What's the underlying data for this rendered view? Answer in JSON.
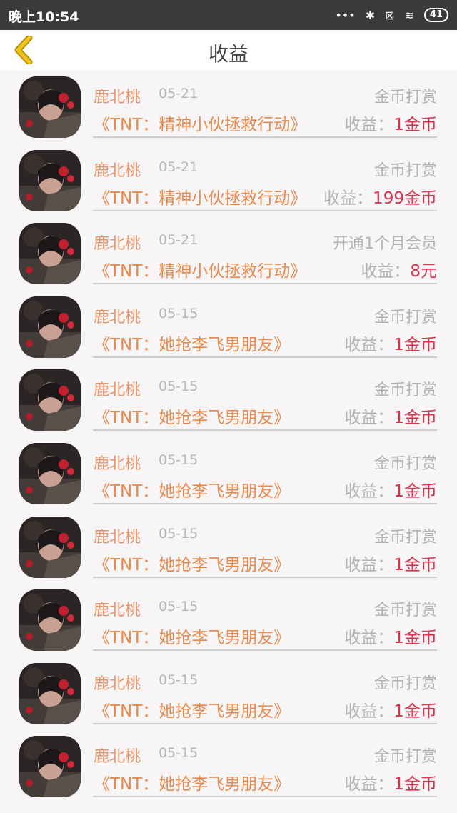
{
  "status": {
    "time": "晚上10:54",
    "battery": "41"
  },
  "header": {
    "title": "收益"
  },
  "rows": [
    {
      "name": "鹿北桃",
      "date": "05-21",
      "type": "金币打赏",
      "book": "《TNT：精神小伙拯救行动》",
      "label": "收益：",
      "value": "1金币"
    },
    {
      "name": "鹿北桃",
      "date": "05-21",
      "type": "金币打赏",
      "book": "《TNT：精神小伙拯救行动》",
      "label": "收益：",
      "value": "199金币"
    },
    {
      "name": "鹿北桃",
      "date": "05-21",
      "type": "开通1个月会员",
      "book": "《TNT：精神小伙拯救行动》",
      "label": "收益：",
      "value": "8元"
    },
    {
      "name": "鹿北桃",
      "date": "05-15",
      "type": "金币打赏",
      "book": "《TNT：她抢李飞男朋友》",
      "label": "收益：",
      "value": "1金币"
    },
    {
      "name": "鹿北桃",
      "date": "05-15",
      "type": "金币打赏",
      "book": "《TNT：她抢李飞男朋友》",
      "label": "收益：",
      "value": "1金币"
    },
    {
      "name": "鹿北桃",
      "date": "05-15",
      "type": "金币打赏",
      "book": "《TNT：她抢李飞男朋友》",
      "label": "收益：",
      "value": "1金币"
    },
    {
      "name": "鹿北桃",
      "date": "05-15",
      "type": "金币打赏",
      "book": "《TNT：她抢李飞男朋友》",
      "label": "收益：",
      "value": "1金币"
    },
    {
      "name": "鹿北桃",
      "date": "05-15",
      "type": "金币打赏",
      "book": "《TNT：她抢李飞男朋友》",
      "label": "收益：",
      "value": "1金币"
    },
    {
      "name": "鹿北桃",
      "date": "05-15",
      "type": "金币打赏",
      "book": "《TNT：她抢李飞男朋友》",
      "label": "收益：",
      "value": "1金币"
    },
    {
      "name": "鹿北桃",
      "date": "05-15",
      "type": "金币打赏",
      "book": "《TNT：她抢李飞男朋友》",
      "label": "收益：",
      "value": "1金币"
    }
  ],
  "colors": {
    "accent": "#e98a4d",
    "value": "#d9334d",
    "back_icon": "#f2c31b"
  },
  "icons": {
    "back": "chevron-left-icon",
    "avatar": "user-avatar-image"
  }
}
